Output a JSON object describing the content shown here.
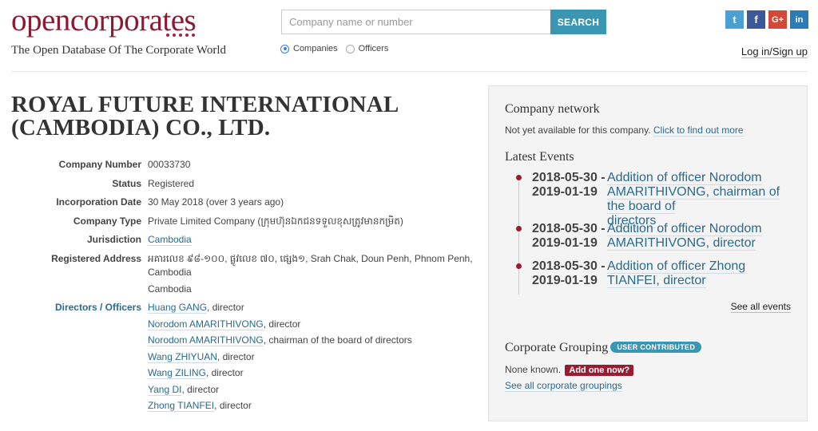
{
  "header": {
    "logo_open": "open",
    "logo_corp": "corporates",
    "tagline": "The Open Database Of The Corporate World",
    "search_placeholder": "Company name or number",
    "search_button": "SEARCH",
    "radio_companies": "Companies",
    "radio_officers": "Officers",
    "selected_radio": "Companies",
    "login": "Log in/Sign up",
    "social": [
      {
        "icon": "twitter-icon",
        "glyph": "t"
      },
      {
        "icon": "facebook-icon",
        "glyph": "f"
      },
      {
        "icon": "google-plus-icon",
        "glyph": "G+"
      },
      {
        "icon": "linkedin-icon",
        "glyph": "in"
      }
    ]
  },
  "company": {
    "title_line1": "ROYAL FUTURE INTERNATIONAL",
    "title_line2": "(CAMBODIA) CO., LTD.",
    "fields": {
      "company_number_label": "Company Number",
      "company_number": "00033730",
      "status_label": "Status",
      "status": "Registered",
      "incorporation_label": "Incorporation Date",
      "incorporation": "30 May 2018 (over 3 years ago)",
      "type_label": "Company Type",
      "type": "Private Limited Company (ក្រុមហ៊ុនឯកជនទទួលខុសត្រូវមានកម្រិត)",
      "jurisdiction_label": "Jurisdiction",
      "jurisdiction": "Cambodia",
      "address_label": "Registered Address",
      "address_line1": "អគារលេខ ៩៨-១០០, ផ្លូវលេខ ៧០, ផ្សេង១, Srah Chak, Doun Penh, Phnom Penh,",
      "address_line2": "Cambodia",
      "address_line3": "Cambodia",
      "directors_label": "Directors / Officers"
    },
    "directors": [
      {
        "name": "Huang GANG",
        "role": ", director"
      },
      {
        "name": "Norodom AMARITHIVONG",
        "role": ", director"
      },
      {
        "name": "Norodom AMARITHIVONG",
        "role": ", chairman of the board of directors"
      },
      {
        "name": "Wang ZHIYUAN",
        "role": ", director"
      },
      {
        "name": "Wang ZILING",
        "role": ", director"
      },
      {
        "name": "Yang DI",
        "role": ", director"
      },
      {
        "name": "Zhong TIANFEI",
        "role": ", director"
      }
    ]
  },
  "sidebar": {
    "network_title": "Company network",
    "network_text": "Not yet available for this company.",
    "network_link": "Click to find out more",
    "events_title": "Latest Events",
    "events": [
      {
        "date1": "2018-05-30 -",
        "date2": "2019-01-19",
        "desc1": "Addition of officer Norodom",
        "desc2": "AMARITHIVONG, chairman of the board of",
        "desc3": "directors"
      },
      {
        "date1": "2018-05-30 -",
        "date2": "2019-01-19",
        "desc1": "Addition of officer Norodom",
        "desc2": "AMARITHIVONG, director",
        "desc3": ""
      },
      {
        "date1": "2018-05-30 -",
        "date2": "2019-01-19",
        "desc1": "Addition of officer Zhong TIANFEI, director",
        "desc2": "",
        "desc3": ""
      }
    ],
    "see_all_events": "See all events",
    "grouping_title": "Corporate Grouping",
    "grouping_badge": "USER CONTRIBUTED",
    "grouping_none": "None known.",
    "grouping_add": "Add one now?",
    "grouping_see_all": "See all corporate groupings"
  }
}
